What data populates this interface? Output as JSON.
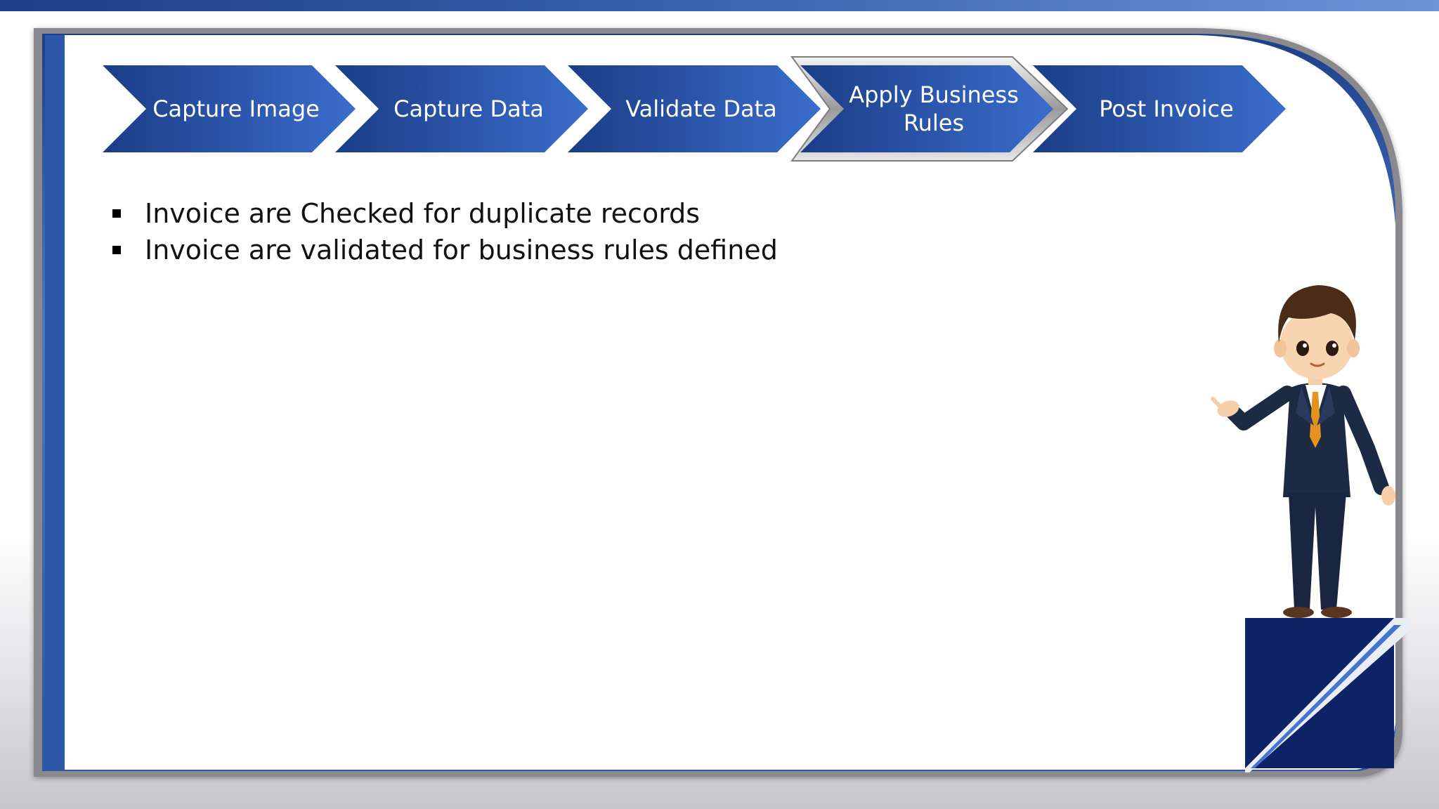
{
  "process": {
    "steps": [
      {
        "label": "Capture Image",
        "active": false
      },
      {
        "label": "Capture Data",
        "active": false
      },
      {
        "label": "Validate Data",
        "active": false
      },
      {
        "label": "Apply Business\nRules",
        "active": true
      },
      {
        "label": "Post Invoice",
        "active": false
      }
    ]
  },
  "bullets": [
    "Invoice are Checked for duplicate records",
    "Invoice are validated for business rules defined"
  ],
  "colors": {
    "chevron_dark": "#1b3d86",
    "chevron_light": "#3a6bc9",
    "frame_blue": "#2d58a8",
    "fold_navy": "#0d2366"
  },
  "illustration": {
    "icon": "businessman-presenting-icon"
  }
}
